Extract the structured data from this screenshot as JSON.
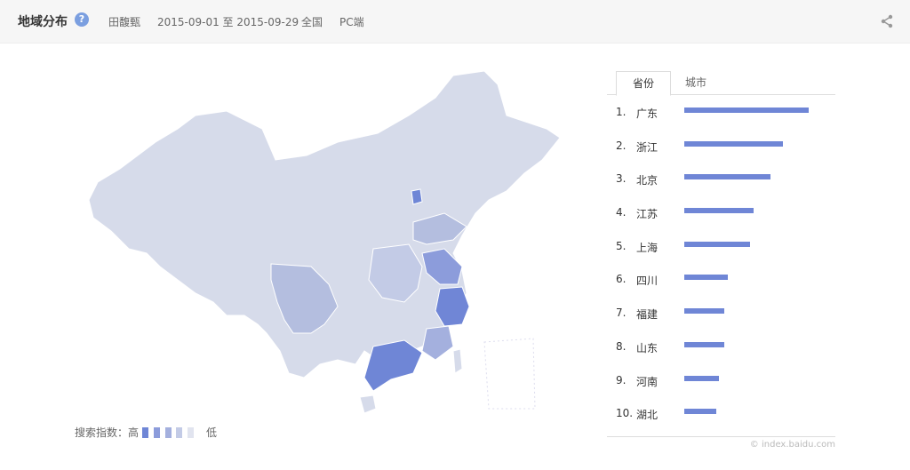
{
  "header": {
    "title": "地域分布",
    "keyword": "田馥甄",
    "date_range": "2015-09-01 至 2015-09-29",
    "region": "全国",
    "platform": "PC端"
  },
  "legend": {
    "label": "搜索指数：高",
    "low": "低"
  },
  "tabs": [
    "省份",
    "城市"
  ],
  "ranking": [
    {
      "index": "1.",
      "name": "广东",
      "value": 100
    },
    {
      "index": "2.",
      "name": "浙江",
      "value": 79
    },
    {
      "index": "3.",
      "name": "北京",
      "value": 69
    },
    {
      "index": "4.",
      "name": "江苏",
      "value": 56
    },
    {
      "index": "5.",
      "name": "上海",
      "value": 53
    },
    {
      "index": "6.",
      "name": "四川",
      "value": 35
    },
    {
      "index": "7.",
      "name": "福建",
      "value": 32
    },
    {
      "index": "8.",
      "name": "山东",
      "value": 32
    },
    {
      "index": "9.",
      "name": "河南",
      "value": 28
    },
    {
      "index": "10.",
      "name": "湖北",
      "value": 26
    }
  ],
  "credit": "© index.baidu.com",
  "colors": {
    "accent": "#6f86d6",
    "map_light": "#d6dbea",
    "map_mid": "#b4bedf",
    "map_strong": "#8c9cdb"
  }
}
